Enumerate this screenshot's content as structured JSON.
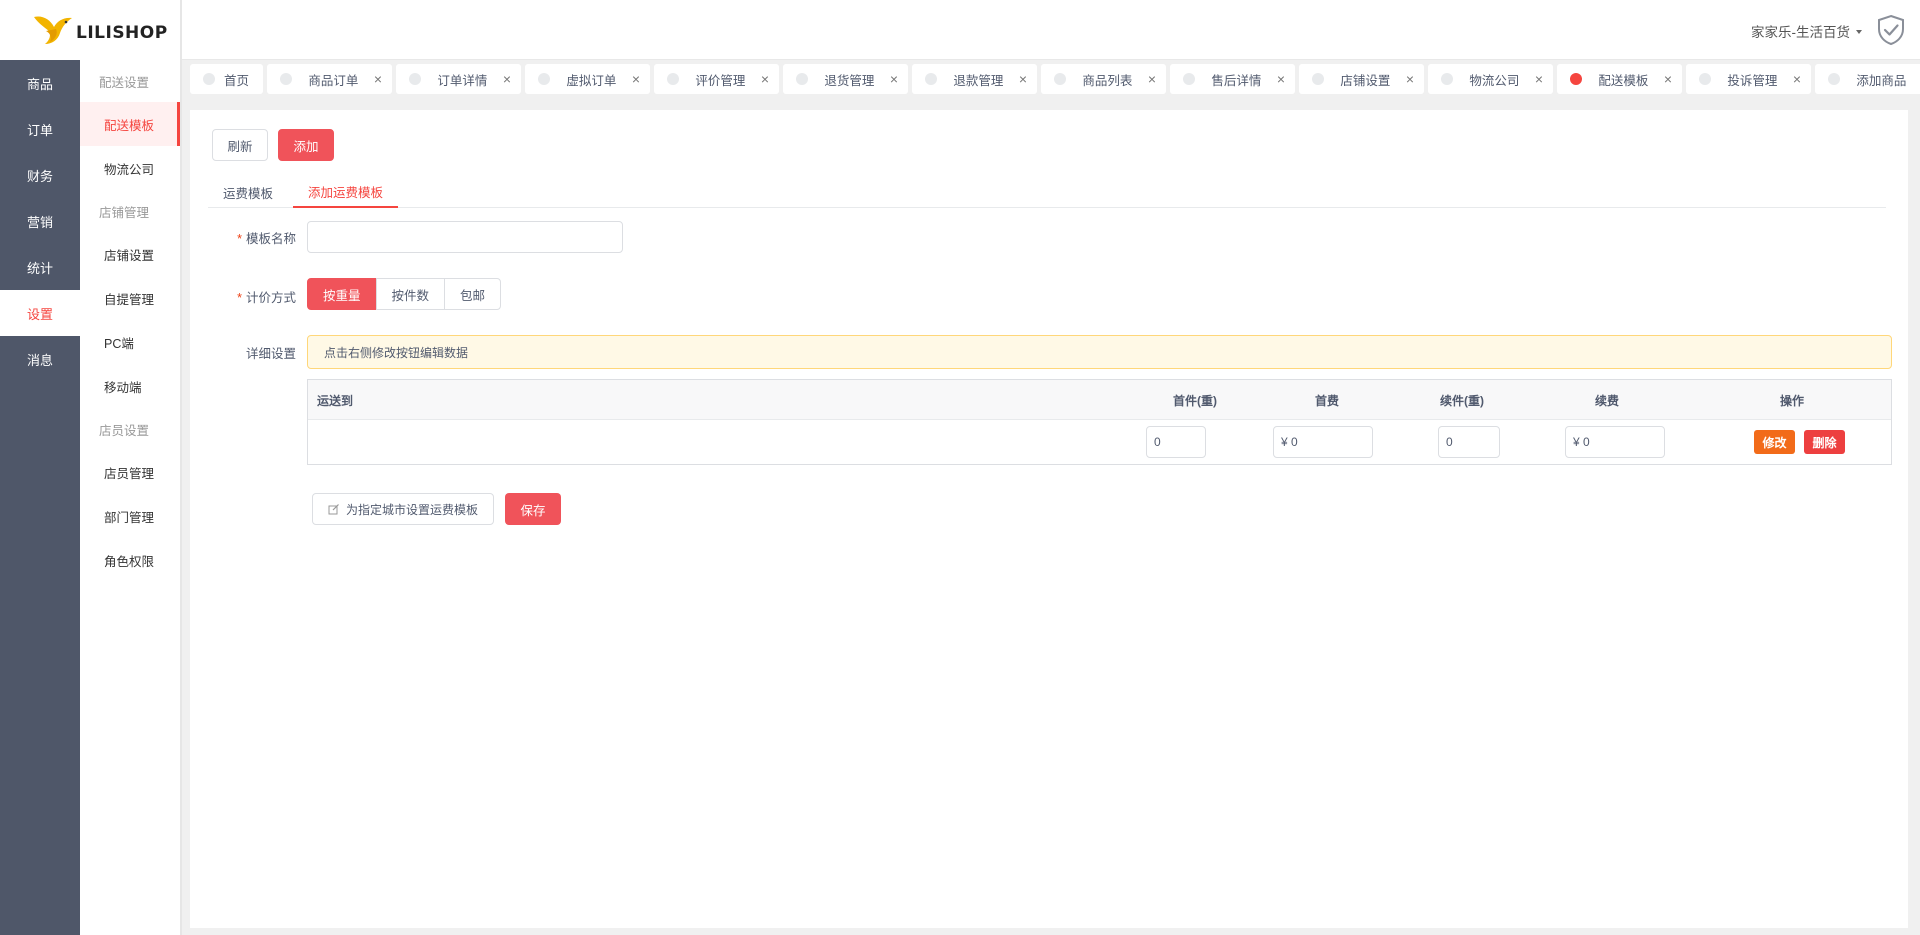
{
  "logo": {
    "text": "LILISHOP"
  },
  "primary_nav": [
    {
      "label": "商品",
      "active": false
    },
    {
      "label": "订单",
      "active": false
    },
    {
      "label": "财务",
      "active": false
    },
    {
      "label": "营销",
      "active": false
    },
    {
      "label": "统计",
      "active": false
    },
    {
      "label": "设置",
      "active": true
    },
    {
      "label": "消息",
      "active": false
    }
  ],
  "secondary_nav": {
    "group_delivery": "配送设置",
    "item_delivery_template": "配送模板",
    "item_logistics": "物流公司",
    "group_store": "店铺管理",
    "item_store_settings": "店铺设置",
    "item_pickup": "自提管理",
    "item_pc": "PC端",
    "item_mobile": "移动端",
    "group_staff": "店员设置",
    "item_staff": "店员管理",
    "item_department": "部门管理",
    "item_roles": "角色权限"
  },
  "header": {
    "store_name": "家家乐-生活百货",
    "shield_icon": "shield-check-icon"
  },
  "tabs": [
    {
      "label": "首页"
    },
    {
      "label": "商品订单"
    },
    {
      "label": "订单详情"
    },
    {
      "label": "虚拟订单"
    },
    {
      "label": "评价管理"
    },
    {
      "label": "退货管理"
    },
    {
      "label": "退款管理"
    },
    {
      "label": "商品列表"
    },
    {
      "label": "售后详情"
    },
    {
      "label": "店铺设置"
    },
    {
      "label": "物流公司"
    },
    {
      "label": "配送模板"
    },
    {
      "label": "投诉管理"
    },
    {
      "label": "添加商品"
    }
  ],
  "tab_close_glyph": "×",
  "toolbar": {
    "refresh_label": "刷新",
    "add_label": "添加"
  },
  "subtabs": {
    "list_label": "运费模板",
    "add_label": "添加运费模板"
  },
  "form": {
    "name_label": "模板名称",
    "name_value": "",
    "pricing_label": "计价方式",
    "pricing_options": [
      "按重量",
      "按件数",
      "包邮"
    ],
    "detail_label": "详细设置",
    "alert_text": "点击右侧修改按钮编辑数据",
    "required_mark": "*"
  },
  "table": {
    "headers": {
      "destination": "运送到",
      "first_weight": "首件(重)",
      "first_fee": "首费",
      "extra_weight": "续件(重)",
      "extra_fee": "续费",
      "actions": "操作"
    },
    "row": {
      "destination": "",
      "first_weight": "0",
      "first_fee": "¥ 0",
      "extra_weight": "0",
      "extra_fee": "¥ 0",
      "edit_label": "修改",
      "delete_label": "删除"
    }
  },
  "footer_buttons": {
    "city_template_label": "为指定城市设置运费模板",
    "save_label": "保存"
  },
  "colors": {
    "accent": "#f0535a",
    "sidebar_bg": "#4f5769",
    "edit_orange": "#f26b19",
    "delete_red": "#ed3f3f"
  }
}
